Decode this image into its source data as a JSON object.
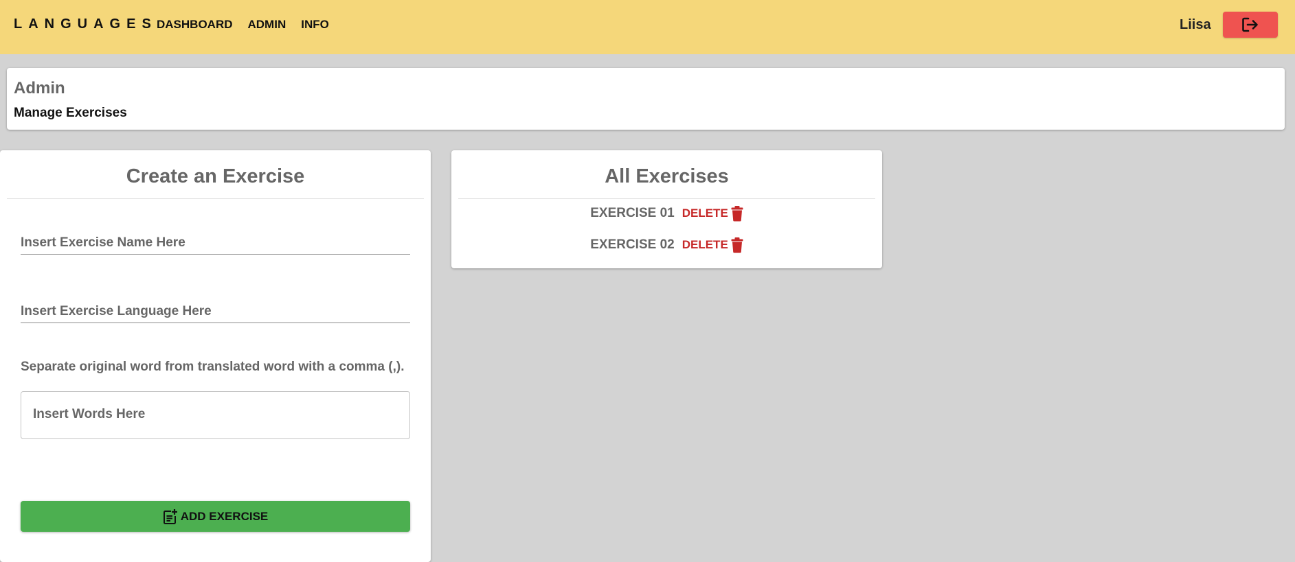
{
  "header": {
    "brand": "LANGUAGES",
    "nav": [
      {
        "label": "DASHBOARD"
      },
      {
        "label": "ADMIN"
      },
      {
        "label": "INFO"
      }
    ],
    "username": "Liisa",
    "logout_icon": "logout-icon"
  },
  "admin": {
    "title": "Admin",
    "subtitle": "Manage Exercises"
  },
  "create": {
    "title": "Create an Exercise",
    "name_placeholder": "Insert Exercise Name Here",
    "language_placeholder": "Insert Exercise Language Here",
    "hint": "Separate original word from translated word with a comma (,).",
    "words_placeholder": "Insert Words Here",
    "add_label": "ADD EXERCISE",
    "add_icon": "post-add-icon"
  },
  "all": {
    "title": "All Exercises",
    "exercises": [
      {
        "name": "EXERCISE 01",
        "delete_label": "DELETE"
      },
      {
        "name": "EXERCISE 02",
        "delete_label": "DELETE"
      }
    ],
    "delete_icon": "trash-icon"
  },
  "colors": {
    "header_bg": "#f5d77a",
    "logout_bg": "#ef5350",
    "page_bg": "#d3d3d3",
    "add_button": "#4caf50",
    "delete_red": "#c62828"
  }
}
